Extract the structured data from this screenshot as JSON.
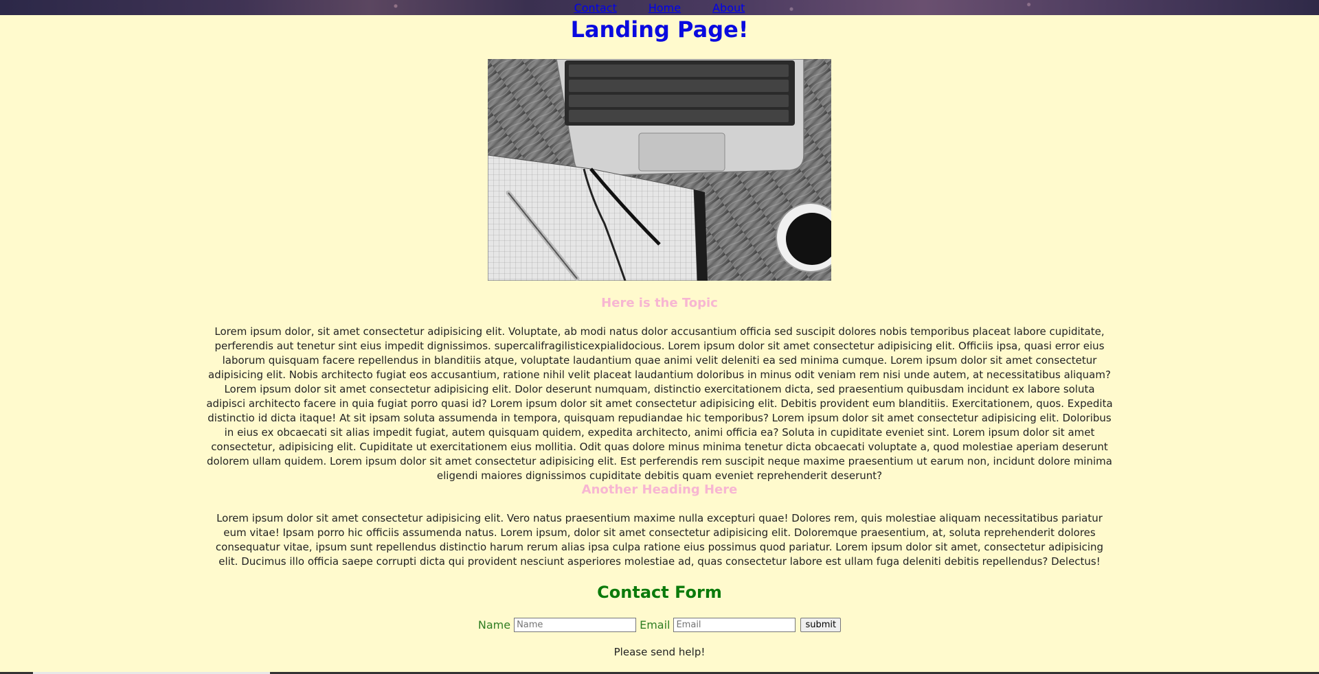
{
  "nav": {
    "links": [
      "Contact",
      "Home",
      "About"
    ]
  },
  "page_title": "Landing Page!",
  "hero_image": {
    "icon": "laptop-notebook-pen-coffee-photo"
  },
  "sections": [
    {
      "heading": "Here is the Topic",
      "paragraph": "Lorem ipsum dolor, sit amet consectetur adipisicing elit. Voluptate, ab modi natus dolor accusantium officia sed suscipit dolores nobis temporibus placeat labore cupiditate, perferendis aut tenetur sint eius impedit dignissimos. supercalifragilisticexpialidocious. Lorem ipsum dolor sit amet consectetur adipisicing elit. Officiis ipsa, quasi error eius laborum quisquam facere repellendus in blanditiis atque, voluptate laudantium quae animi velit deleniti ea sed minima cumque. Lorem ipsum dolor sit amet consectetur adipisicing elit. Nobis architecto fugiat eos accusantium, ratione nihil velit placeat laudantium doloribus in minus odit veniam rem nisi unde autem, at necessitatibus aliquam? Lorem ipsum dolor sit amet consectetur adipisicing elit. Dolor deserunt numquam, distinctio exercitationem dicta, sed praesentium quibusdam incidunt ex labore soluta adipisci architecto facere in quia fugiat porro quasi id? Lorem ipsum dolor sit amet consectetur adipisicing elit. Debitis provident eum blanditiis. Exercitationem, quos. Expedita distinctio id dicta itaque! At sit ipsam soluta assumenda in tempora, quisquam repudiandae hic temporibus? Lorem ipsum dolor sit amet consectetur adipisicing elit. Doloribus in eius ex obcaecati sit alias impedit fugiat, autem quisquam quidem, expedita architecto, animi officia ea? Soluta in cupiditate eveniet sint. Lorem ipsum dolor sit amet consectetur, adipisicing elit. Cupiditate ut exercitationem eius mollitia. Odit quas dolore minus minima tenetur dicta obcaecati voluptate a, quod molestiae aperiam deserunt dolorem ullam quidem. Lorem ipsum dolor sit amet consectetur adipisicing elit. Est perferendis rem suscipit neque maxime praesentium ut earum non, incidunt dolore minima eligendi maiores dignissimos cupiditate debitis quam eveniet reprehenderit deserunt?"
    },
    {
      "heading": "Another Heading Here",
      "paragraph": "Lorem ipsum dolor sit amet consectetur adipisicing elit. Vero natus praesentium maxime nulla excepturi quae! Dolores rem, quis molestiae aliquam necessitatibus pariatur eum vitae! Ipsam porro hic officiis assumenda natus. Lorem ipsum, dolor sit amet consectetur adipisicing elit. Doloremque praesentium, at, soluta reprehenderit dolores consequatur vitae, ipsum sunt repellendus distinctio harum rerum alias ipsa culpa ratione eius possimus quod pariatur. Lorem ipsum dolor sit amet, consectetur adipisicing elit. Ducimus illo officia saepe corrupti dicta qui provident nesciunt asperiores molestiae ad, quas consectetur labore est ullam fuga deleniti debitis repellendus? Delectus!"
    }
  ],
  "contact": {
    "heading": "Contact Form",
    "name_label": "Name",
    "name_placeholder": "Name",
    "email_label": "Email",
    "email_placeholder": "Email",
    "submit_label": "submit",
    "help_text": "Please send help!"
  },
  "colors": {
    "background": "#fffacd",
    "title": "#0a0adf",
    "section_heading": "#f7b6d2",
    "contact_heading": "#0b7a0b",
    "link": "#0000ee"
  }
}
